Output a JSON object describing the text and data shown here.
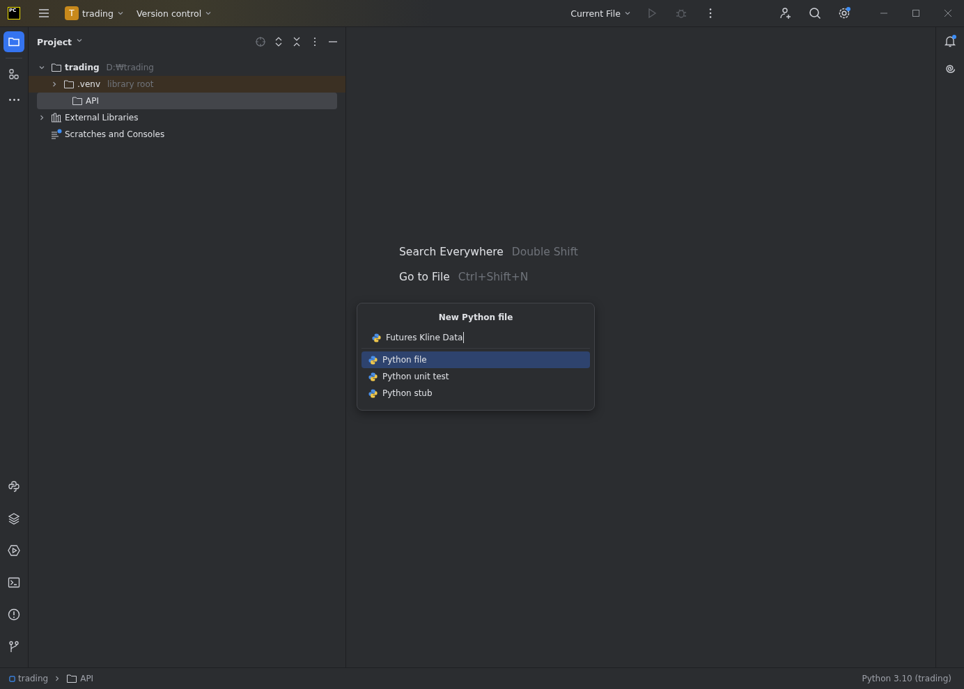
{
  "title_bar": {
    "logo_text": "PC",
    "project_badge": "T",
    "project": "trading",
    "vcs": "Version control",
    "run_config": "Current File",
    "actions": [
      {
        "kind": "run",
        "disabled": true
      },
      {
        "kind": "debug",
        "disabled": true
      }
    ],
    "settings_update": true
  },
  "left_tools": [
    {
      "kind": "folder",
      "selected": true
    },
    {
      "kind": "structure",
      "selected": false
    },
    {
      "kind": "more",
      "selected": false
    }
  ],
  "bottom_tools": [
    {
      "kind": "python"
    },
    {
      "kind": "layers"
    },
    {
      "kind": "services"
    },
    {
      "kind": "terminal"
    },
    {
      "kind": "problems"
    },
    {
      "kind": "git"
    }
  ],
  "project_panel": {
    "title": "Project",
    "tree": [
      {
        "name": "trading",
        "hint": "D:₩trading",
        "kind": "folder",
        "bold": true,
        "expanded": true,
        "selected": false,
        "highlighted": false,
        "children": [
          {
            "name": ".venv",
            "hint": "library root",
            "kind": "folder",
            "bold": false,
            "expanded": false,
            "selected": false,
            "highlighted": true
          },
          {
            "name": "API",
            "kind": "folder",
            "bold": false,
            "selected": true,
            "highlighted": false
          }
        ]
      },
      {
        "name": "External Libraries",
        "kind": "library",
        "bold": false,
        "expanded": false,
        "selected": false,
        "highlighted": false
      },
      {
        "name": "Scratches and Consoles",
        "kind": "scratches",
        "bold": false,
        "selected": false,
        "highlighted": false
      }
    ]
  },
  "editor_hints": [
    {
      "action": "Search Everywhere",
      "shortcut": "Double Shift"
    },
    {
      "action": "Go to File",
      "shortcut": "Ctrl+Shift+N"
    }
  ],
  "dialog": {
    "title": "New Python file",
    "value": "Futures Kline Data",
    "options": [
      {
        "label": "Python file",
        "selected": true
      },
      {
        "label": "Python unit test",
        "selected": false
      },
      {
        "label": "Python stub",
        "selected": false
      }
    ]
  },
  "right_tools": [
    {
      "kind": "notifications",
      "unread": true
    },
    {
      "kind": "ai",
      "unread": false
    }
  ],
  "status_bar": {
    "breadcrumbs": [
      {
        "label": "trading",
        "kind": "module"
      },
      {
        "label": "API",
        "kind": "folder"
      }
    ],
    "interpreter": "Python 3.10 (trading)"
  }
}
